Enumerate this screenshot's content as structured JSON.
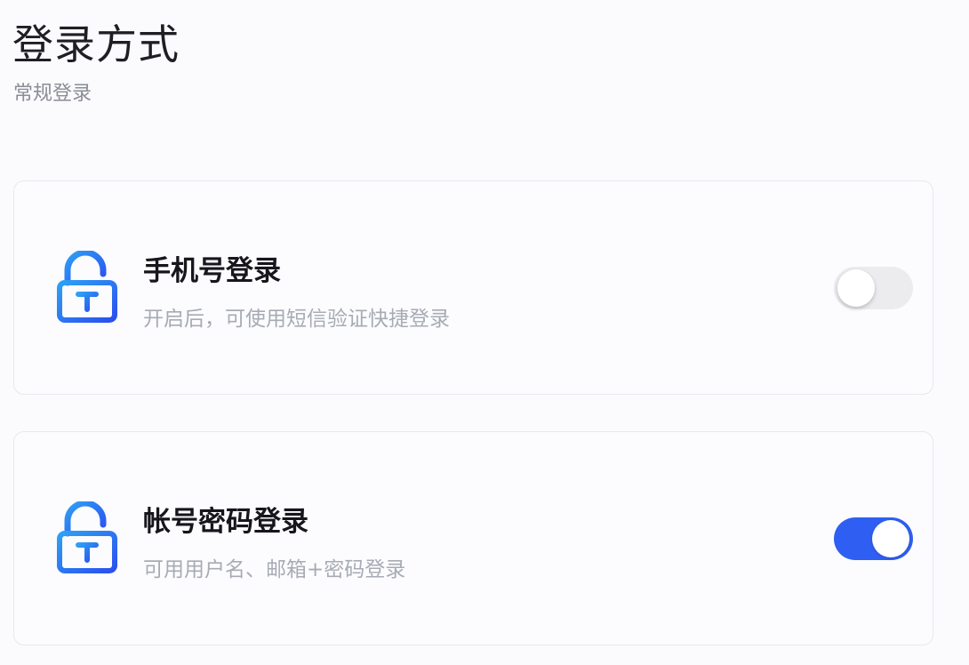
{
  "header": {
    "title": "登录方式",
    "subtitle": "常规登录"
  },
  "colors": {
    "accent": "#2f5ff2",
    "icon_gradient_start": "#2ea0f4",
    "icon_gradient_end": "#2b4ff0",
    "toggle_off": "#ececef"
  },
  "options": [
    {
      "title": "手机号登录",
      "description": "开启后，可使用短信验证快捷登录",
      "icon": "lock-open-icon",
      "enabled": false
    },
    {
      "title": "帐号密码登录",
      "description": "可用用户名、邮箱+密码登录",
      "icon": "lock-open-icon",
      "enabled": true
    }
  ]
}
